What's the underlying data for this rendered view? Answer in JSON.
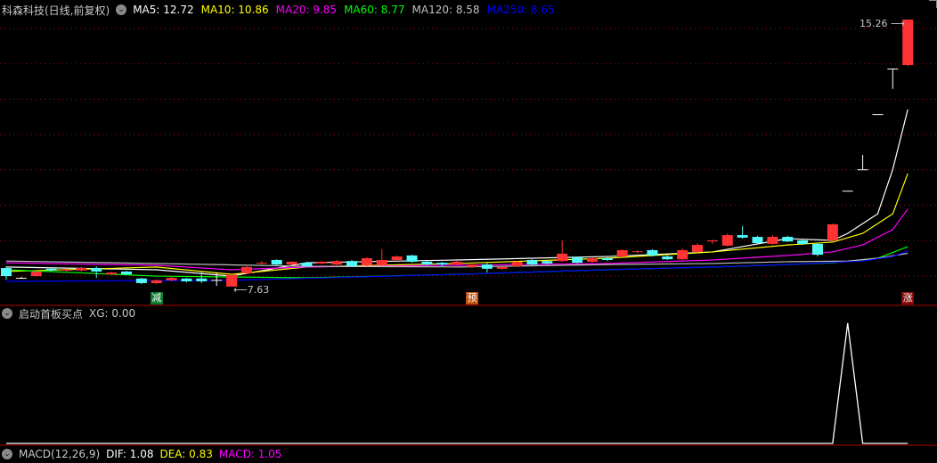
{
  "main_panel": {
    "title": "科森科技(日线,前复权)",
    "menu_icon": "chevron-down-icon",
    "ma_legend": [
      {
        "label": "MA5: 12.72",
        "color": "#ffffff"
      },
      {
        "label": "MA10: 10.86",
        "color": "#ffff00"
      },
      {
        "label": "MA20: 9.85",
        "color": "#ff00ff"
      },
      {
        "label": "MA60: 8.77",
        "color": "#00ff00"
      },
      {
        "label": "MA120: 8.58",
        "color": "#c0c0c0"
      },
      {
        "label": "MA250: 8.65",
        "color": "#0000ff"
      }
    ],
    "high_label": "15.26",
    "low_label": "7.63",
    "markers": [
      {
        "text": "减",
        "index": 10,
        "color": "#0a7a2a"
      },
      {
        "text": "预",
        "index": 31,
        "color": "#c05010"
      },
      {
        "text": "涨",
        "index": 60,
        "color": "#8a0a0a"
      }
    ]
  },
  "indicator_panel": {
    "title": "启动首板买点",
    "value_label": "XG: 0.00",
    "menu_icon": "chevron-down-icon"
  },
  "macd_panel": {
    "title": "MACD(12,26,9)",
    "dif": "DIF: 1.08",
    "dea": "DEA: 0.83",
    "macd": "MACD: 1.05"
  },
  "colors": {
    "up": "#ff3333",
    "down": "#54fcfc",
    "grid": "#a01010",
    "doji": "#ffffff"
  },
  "chart_data": {
    "type": "candlestick",
    "price_range": [
      7.5,
      15.4
    ],
    "candles": [
      [
        8.16,
        7.93,
        8.21,
        7.83
      ],
      [
        7.88,
        7.88,
        7.91,
        7.86
      ],
      [
        7.93,
        8.06,
        8.08,
        7.91
      ],
      [
        8.14,
        8.09,
        8.16,
        8.06
      ],
      [
        8.09,
        8.11,
        8.14,
        8.06
      ],
      [
        8.09,
        8.16,
        8.19,
        8.06
      ],
      [
        8.16,
        8.06,
        8.21,
        7.88
      ],
      [
        7.98,
        8.03,
        8.06,
        7.96
      ],
      [
        8.06,
        7.98,
        8.08,
        7.96
      ],
      [
        7.86,
        7.73,
        7.88,
        7.7
      ],
      [
        7.73,
        7.81,
        7.83,
        7.7
      ],
      [
        7.81,
        7.88,
        7.91,
        7.78
      ],
      [
        7.86,
        7.78,
        7.88,
        7.75
      ],
      [
        7.86,
        7.78,
        8.06,
        7.73
      ],
      [
        7.82,
        7.82,
        8.03,
        7.65
      ],
      [
        7.63,
        7.96,
        7.98,
        7.63
      ],
      [
        8.01,
        8.19,
        8.21,
        7.98
      ],
      [
        8.29,
        8.31,
        8.36,
        8.24
      ],
      [
        8.39,
        8.26,
        8.41,
        8.24
      ],
      [
        8.26,
        8.34,
        8.36,
        8.24
      ],
      [
        8.31,
        8.21,
        8.34,
        8.19
      ],
      [
        8.29,
        8.34,
        8.36,
        8.26
      ],
      [
        8.26,
        8.36,
        8.39,
        8.24
      ],
      [
        8.36,
        8.21,
        8.39,
        8.19
      ],
      [
        8.24,
        8.44,
        8.47,
        8.21
      ],
      [
        8.24,
        8.39,
        8.7,
        8.21
      ],
      [
        8.39,
        8.49,
        8.52,
        8.36
      ],
      [
        8.52,
        8.34,
        8.54,
        8.31
      ],
      [
        8.34,
        8.26,
        8.36,
        8.24
      ],
      [
        8.31,
        8.26,
        8.34,
        8.21
      ],
      [
        8.26,
        8.34,
        8.36,
        8.24
      ],
      [
        8.19,
        8.26,
        8.29,
        8.16
      ],
      [
        8.26,
        8.14,
        8.31,
        8.03
      ],
      [
        8.14,
        8.19,
        8.21,
        8.11
      ],
      [
        8.21,
        8.34,
        8.36,
        8.19
      ],
      [
        8.39,
        8.26,
        8.41,
        8.24
      ],
      [
        8.36,
        8.29,
        8.39,
        8.26
      ],
      [
        8.36,
        8.57,
        8.95,
        8.34
      ],
      [
        8.47,
        8.31,
        8.49,
        8.29
      ],
      [
        8.34,
        8.44,
        8.47,
        8.31
      ],
      [
        8.44,
        8.39,
        8.47,
        8.36
      ],
      [
        8.49,
        8.67,
        8.7,
        8.47
      ],
      [
        8.62,
        8.64,
        8.67,
        8.59
      ],
      [
        8.67,
        8.52,
        8.7,
        8.49
      ],
      [
        8.49,
        8.41,
        8.52,
        8.39
      ],
      [
        8.41,
        8.67,
        8.72,
        8.39
      ],
      [
        8.62,
        8.82,
        8.87,
        8.59
      ],
      [
        8.92,
        8.95,
        8.97,
        8.85
      ],
      [
        8.8,
        9.1,
        9.15,
        8.77
      ],
      [
        9.1,
        9.03,
        9.36,
        9.0
      ],
      [
        9.05,
        8.87,
        9.08,
        8.85
      ],
      [
        8.85,
        9.05,
        9.1,
        8.82
      ],
      [
        9.05,
        8.92,
        9.08,
        8.9
      ],
      [
        8.95,
        8.85,
        8.97,
        8.82
      ],
      [
        8.85,
        8.54,
        8.87,
        8.49
      ],
      [
        8.95,
        9.41,
        9.43,
        8.92
      ],
      [
        10.37,
        10.37,
        10.37,
        10.37
      ],
      [
        10.98,
        10.98,
        11.39,
        10.98
      ],
      [
        12.56,
        12.56,
        12.56,
        12.56
      ],
      [
        13.86,
        13.86,
        13.86,
        13.28
      ],
      [
        13.96,
        15.26,
        15.26,
        13.93
      ]
    ],
    "ma_lines": [
      {
        "name": "MA5",
        "color": "#ffffff",
        "points": [
          [
            0,
            8.19
          ],
          [
            10,
            8.11
          ],
          [
            15,
            7.93
          ],
          [
            20,
            8.31
          ],
          [
            30,
            8.39
          ],
          [
            40,
            8.49
          ],
          [
            47,
            8.62
          ],
          [
            52,
            9.0
          ],
          [
            55,
            8.95
          ],
          [
            56,
            9.15
          ],
          [
            58,
            9.71
          ],
          [
            59,
            10.98
          ],
          [
            60,
            12.69
          ]
        ]
      },
      {
        "name": "MA10",
        "color": "#ffff00",
        "points": [
          [
            0,
            8.06
          ],
          [
            10,
            8.19
          ],
          [
            15,
            7.98
          ],
          [
            20,
            8.19
          ],
          [
            30,
            8.29
          ],
          [
            40,
            8.44
          ],
          [
            47,
            8.62
          ],
          [
            52,
            8.82
          ],
          [
            55,
            8.9
          ],
          [
            57,
            9.15
          ],
          [
            59,
            9.71
          ],
          [
            60,
            10.86
          ]
        ]
      },
      {
        "name": "MA20",
        "color": "#ff00ff",
        "points": [
          [
            0,
            8.31
          ],
          [
            10,
            8.24
          ],
          [
            15,
            8.11
          ],
          [
            20,
            8.19
          ],
          [
            30,
            8.24
          ],
          [
            40,
            8.29
          ],
          [
            47,
            8.39
          ],
          [
            52,
            8.52
          ],
          [
            55,
            8.62
          ],
          [
            57,
            8.82
          ],
          [
            59,
            9.26
          ],
          [
            60,
            9.85
          ]
        ]
      },
      {
        "name": "MA60",
        "color": "#00ff00",
        "points": [
          [
            0,
            8.11
          ],
          [
            10,
            7.93
          ],
          [
            20,
            7.88
          ],
          [
            30,
            7.98
          ],
          [
            40,
            8.11
          ],
          [
            47,
            8.19
          ],
          [
            52,
            8.26
          ],
          [
            55,
            8.31
          ],
          [
            58,
            8.44
          ],
          [
            60,
            8.77
          ]
        ]
      },
      {
        "name": "MA120",
        "color": "#c0c0c0",
        "points": [
          [
            0,
            8.36
          ],
          [
            10,
            8.29
          ],
          [
            20,
            8.21
          ],
          [
            30,
            8.19
          ],
          [
            40,
            8.26
          ],
          [
            47,
            8.29
          ],
          [
            52,
            8.34
          ],
          [
            56,
            8.36
          ],
          [
            58,
            8.44
          ],
          [
            60,
            8.58
          ]
        ]
      },
      {
        "name": "MA250",
        "color": "#0000ff",
        "points": [
          [
            0,
            7.78
          ],
          [
            15,
            7.81
          ],
          [
            30,
            7.98
          ],
          [
            40,
            8.11
          ],
          [
            47,
            8.19
          ],
          [
            52,
            8.26
          ],
          [
            57,
            8.36
          ],
          [
            59,
            8.49
          ],
          [
            60,
            8.65
          ]
        ]
      }
    ],
    "xg_values_nonzero": [
      [
        56,
        1
      ]
    ],
    "xg_count": 61
  }
}
